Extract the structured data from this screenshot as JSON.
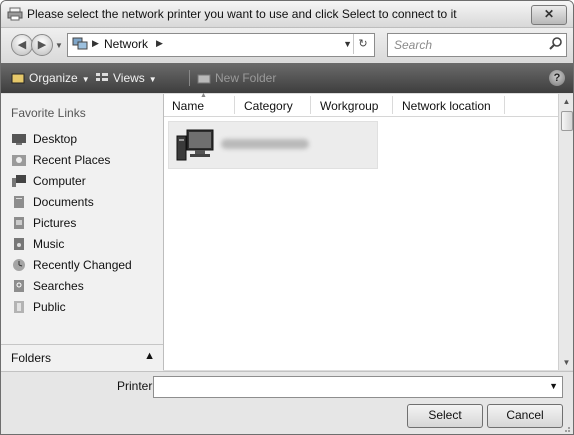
{
  "window": {
    "title": "Please select the network printer you want to use and click Select to connect to it",
    "close_label": "✕"
  },
  "address": {
    "crumbs": [
      "Network"
    ],
    "search_placeholder": "Search"
  },
  "toolbar": {
    "organize": "Organize",
    "views": "Views",
    "new_folder": "New Folder",
    "help": "?"
  },
  "sidebar": {
    "section_title": "Favorite Links",
    "items": [
      {
        "label": "Desktop",
        "icon": "desktop-icon"
      },
      {
        "label": "Recent Places",
        "icon": "recent-places-icon"
      },
      {
        "label": "Computer",
        "icon": "computer-icon"
      },
      {
        "label": "Documents",
        "icon": "documents-icon"
      },
      {
        "label": "Pictures",
        "icon": "pictures-icon"
      },
      {
        "label": "Music",
        "icon": "music-icon"
      },
      {
        "label": "Recently Changed",
        "icon": "recently-changed-icon"
      },
      {
        "label": "Searches",
        "icon": "searches-icon"
      },
      {
        "label": "Public",
        "icon": "public-icon"
      }
    ],
    "folders_label": "Folders"
  },
  "columns": [
    "Name",
    "Category",
    "Workgroup",
    "Network location"
  ],
  "items": [
    {
      "name": "",
      "icon": "network-computer-icon",
      "name_obscured": true
    }
  ],
  "footer": {
    "printer_label": "Printer",
    "printer_value": "",
    "select_label": "Select",
    "cancel_label": "Cancel"
  },
  "colors": {
    "toolbar_bg": "#4a4a4a",
    "nav_bg": "#f1f1f1",
    "selection_bg": "#ececec"
  }
}
